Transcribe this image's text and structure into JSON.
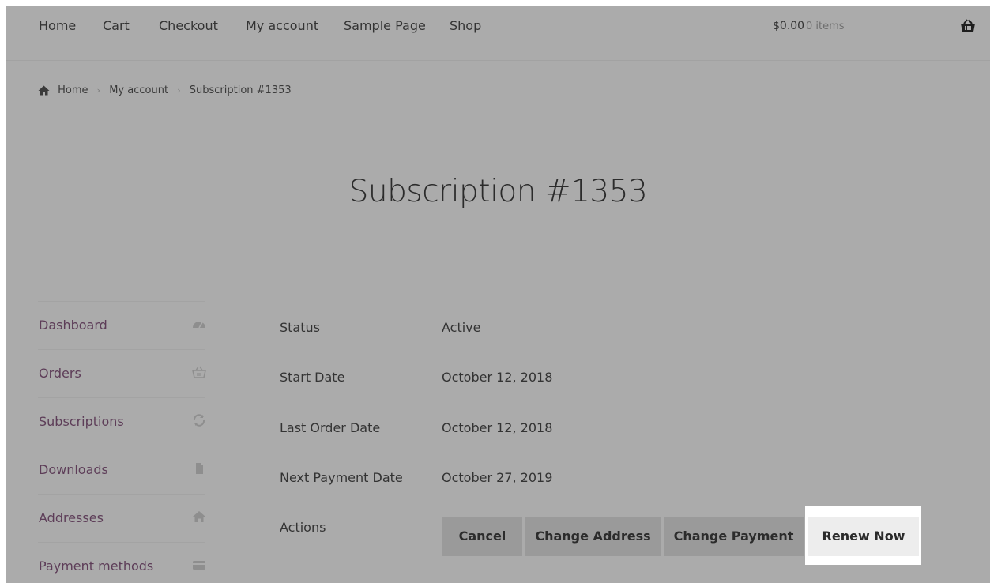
{
  "nav": {
    "links": [
      "Home",
      "Cart",
      "Checkout",
      "My account",
      "Sample Page",
      "Shop"
    ],
    "cart_amount": "$0.00",
    "cart_items": "0 items",
    "cart_icon": "basket-icon"
  },
  "breadcrumb": {
    "home_icon": "home-icon",
    "items": [
      "Home",
      "My account",
      "Subscription #1353"
    ]
  },
  "page": {
    "title": "Subscription #1353"
  },
  "sidebar": {
    "items": [
      {
        "label": "Dashboard",
        "icon": "dashboard-icon"
      },
      {
        "label": "Orders",
        "icon": "basket-icon"
      },
      {
        "label": "Subscriptions",
        "icon": "refresh-icon"
      },
      {
        "label": "Downloads",
        "icon": "file-icon"
      },
      {
        "label": "Addresses",
        "icon": "home-icon"
      },
      {
        "label": "Payment methods",
        "icon": "credit-card-icon"
      }
    ]
  },
  "details": [
    {
      "label": "Status",
      "value": "Active"
    },
    {
      "label": "Start Date",
      "value": "October 12, 2018"
    },
    {
      "label": "Last Order Date",
      "value": "October 12, 2018"
    },
    {
      "label": "Next Payment Date",
      "value": "October 27, 2019"
    }
  ],
  "actions": {
    "label": "Actions",
    "buttons": [
      "Cancel",
      "Change Address",
      "Change Payment",
      "Renew Now"
    ]
  },
  "colors": {
    "overlay": "#ababab",
    "sidebar_link": "#5d3d58",
    "highlight": "#ffffff"
  }
}
